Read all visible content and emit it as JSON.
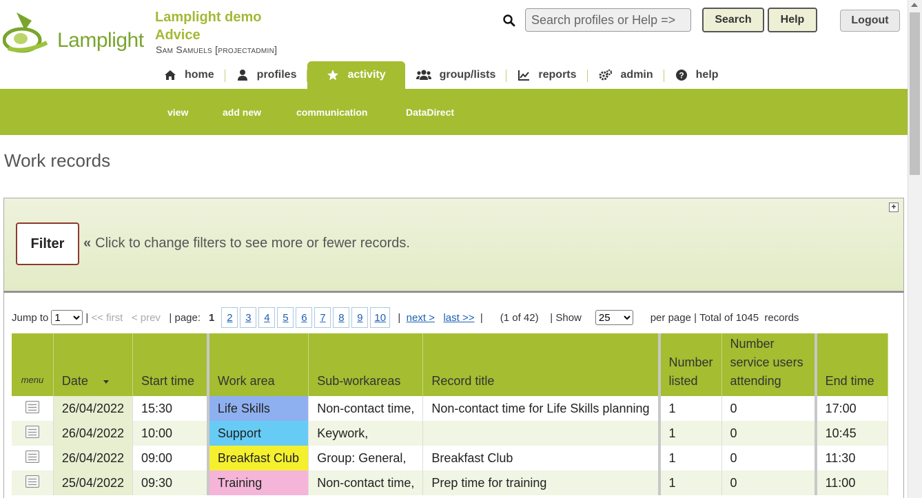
{
  "header": {
    "logo_text": "Lamplight",
    "site_title_line1": "Lamplight demo",
    "site_title_line2": "Advice",
    "user": "Sam Samuels [projectadmin]",
    "search_placeholder": "Search profiles or Help =>",
    "search_button": "Search",
    "help_button": "Help",
    "logout_button": "Logout"
  },
  "nav": {
    "items": [
      {
        "label": "home",
        "icon": "home-icon"
      },
      {
        "label": "profiles",
        "icon": "user-icon"
      },
      {
        "label": "activity",
        "icon": "star-icon",
        "active": true
      },
      {
        "label": "group/lists",
        "icon": "users-icon"
      },
      {
        "label": "reports",
        "icon": "chart-icon"
      },
      {
        "label": "admin",
        "icon": "gears-icon"
      },
      {
        "label": "help",
        "icon": "question-icon"
      }
    ]
  },
  "subnav": {
    "items": [
      "view",
      "add new",
      "communication",
      "DataDirect"
    ]
  },
  "page": {
    "title": "Work records"
  },
  "filter": {
    "button": "Filter",
    "hint": "Click to change filters to see more or fewer records.",
    "expand_symbol": "+"
  },
  "pager": {
    "jump_label": "Jump to",
    "jump_value": "1",
    "first": "<< first",
    "prev": "< prev",
    "page_label": "page:",
    "current_page": "1",
    "pages": [
      "2",
      "3",
      "4",
      "5",
      "6",
      "7",
      "8",
      "9",
      "10"
    ],
    "next": "next >",
    "last": "last >>",
    "position": "(1 of 42)",
    "show_label": "Show",
    "per_page_value": "25",
    "per_page_label": "per page",
    "total_label": "Total of 1045  records"
  },
  "table": {
    "columns": [
      "menu",
      "Date",
      "Start time",
      "Work area",
      "Sub-workareas",
      "Record title",
      "Number listed",
      "Number service users attending",
      "End time"
    ],
    "rows": [
      {
        "date": "26/04/2022",
        "start": "15:30",
        "area": "Life Skills",
        "area_color": "#8fb0f0",
        "sub": "Non-contact time,",
        "title": "Non-contact time for Life Skills planning",
        "listed": "1",
        "attending": "0",
        "end": "17:00"
      },
      {
        "date": "26/04/2022",
        "start": "10:00",
        "area": "Support",
        "area_color": "#66ccf5",
        "sub": "Keywork,",
        "title": "",
        "listed": "1",
        "attending": "0",
        "end": "10:45"
      },
      {
        "date": "26/04/2022",
        "start": "09:00",
        "area": "Breakfast Club",
        "area_color": "#f5f02e",
        "sub": "Group: General,",
        "title": "Breakfast Club",
        "listed": "1",
        "attending": "0",
        "end": "11:30"
      },
      {
        "date": "25/04/2022",
        "start": "09:30",
        "area": "Training",
        "area_color": "#f5b5d8",
        "sub": "Non-contact time,",
        "title": "Prep time for training",
        "listed": "1",
        "attending": "0",
        "end": "11:00"
      }
    ]
  },
  "colors": {
    "brand_green": "#a4bd31",
    "title_green": "#a3b935"
  }
}
